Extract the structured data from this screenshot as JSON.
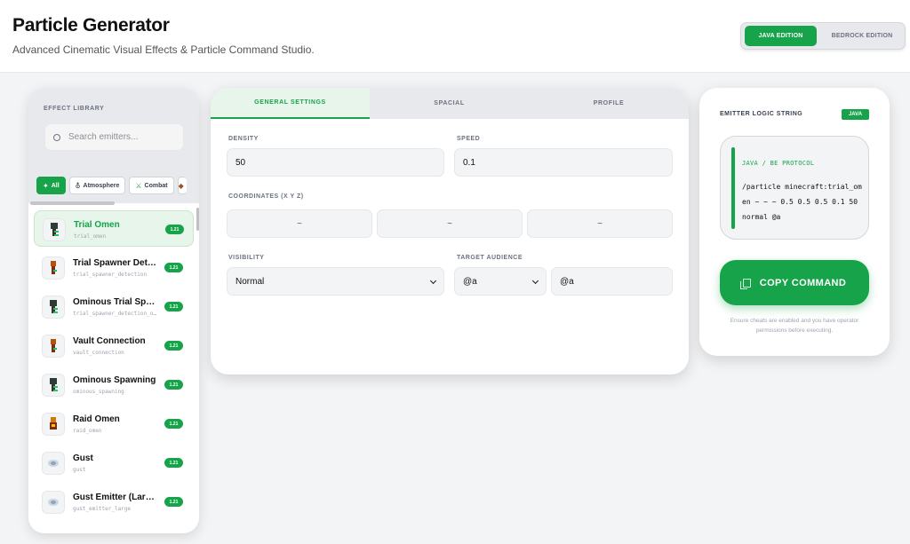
{
  "header": {
    "title": "Particle Generator",
    "subtitle": "Advanced Cinematic Visual Effects & Particle Command Studio.",
    "editions": [
      "JAVA EDITION",
      "BEDROCK EDITION"
    ]
  },
  "library": {
    "label": "EFFECT LIBRARY",
    "search_placeholder": "Search emitters...",
    "chips": [
      {
        "label": "All",
        "icon": "✦"
      },
      {
        "label": "Atmosphere",
        "icon": "⛢"
      },
      {
        "label": "Combat",
        "icon": "⚔"
      }
    ],
    "items": [
      {
        "name": "Trial Omen",
        "id": "trial_omen",
        "badge": "1.21"
      },
      {
        "name": "Trial Spawner Detection",
        "id": "trial_spawner_detection",
        "badge": "1.21"
      },
      {
        "name": "Ominous Trial Spawner Detection",
        "id": "trial_spawner_detection_ominous",
        "badge": "1.21"
      },
      {
        "name": "Vault Connection",
        "id": "vault_connection",
        "badge": "1.21"
      },
      {
        "name": "Ominous Spawning",
        "id": "ominous_spawning",
        "badge": "1.21"
      },
      {
        "name": "Raid Omen",
        "id": "raid_omen",
        "badge": "1.21"
      },
      {
        "name": "Gust",
        "id": "gust",
        "badge": "1.21"
      },
      {
        "name": "Gust Emitter (Large)",
        "id": "gust_emitter_large",
        "badge": "1.21"
      }
    ]
  },
  "settings": {
    "tabs": [
      "GENERAL SETTINGS",
      "SPACIAL",
      "PROFILE"
    ],
    "density_label": "DENSITY",
    "density_value": "50",
    "speed_label": "SPEED",
    "speed_value": "0.1",
    "coords_label": "COORDINATES (X Y Z)",
    "coords": [
      "~",
      "~",
      "~"
    ],
    "visibility_label": "VISIBILITY",
    "visibility_value": "Normal",
    "audience_label": "TARGET AUDIENCE",
    "audience_selector": "@a",
    "audience_value": "@a"
  },
  "output": {
    "label": "EMITTER LOGIC STRING",
    "badge": "JAVA",
    "protocol": "JAVA / BE PROTOCOL",
    "command": "/particle minecraft:trial_omen ~ ~ ~ 0.5 0.5 0.5 0.1 50 normal @a",
    "copy_label": "COPY COMMAND",
    "warning": "Ensure cheats are enabled and you have operator permissions before executing."
  },
  "colors": {
    "accent": "#16a34a",
    "accent_light": "#e8f5ea",
    "panel": "#ffffff",
    "background": "#f3f4f6"
  }
}
